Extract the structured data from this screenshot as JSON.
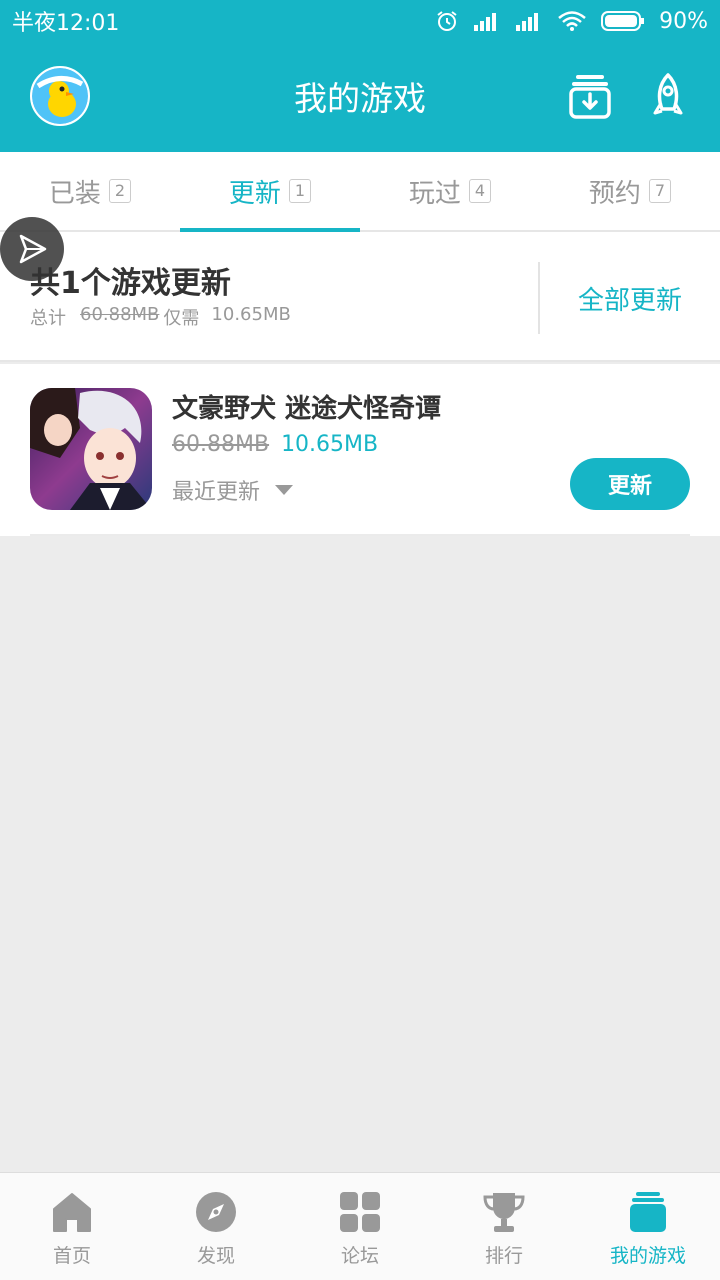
{
  "status_bar": {
    "time": "半夜12:01",
    "battery": "90%"
  },
  "header": {
    "title": "我的游戏"
  },
  "tabs": [
    {
      "label": "已装",
      "count": "2"
    },
    {
      "label": "更新",
      "count": "1",
      "active": true
    },
    {
      "label": "玩过",
      "count": "4"
    },
    {
      "label": "预约",
      "count": "7"
    }
  ],
  "summary": {
    "title": "共1个游戏更新",
    "total_label": "总计",
    "total_size": "60.88MB",
    "only_label": "仅需",
    "only_size": "10.65MB",
    "update_all": "全部更新"
  },
  "games": [
    {
      "name": "文豪野犬 迷途犬怪奇谭",
      "old_size": "60.88MB",
      "new_size": "10.65MB",
      "recent_label": "最近更新",
      "update_label": "更新"
    }
  ],
  "bottom_nav": [
    {
      "label": "首页",
      "icon": "home-icon"
    },
    {
      "label": "发现",
      "icon": "compass-icon"
    },
    {
      "label": "论坛",
      "icon": "grid-icon"
    },
    {
      "label": "排行",
      "icon": "trophy-icon"
    },
    {
      "label": "我的游戏",
      "icon": "stack-icon",
      "active": true
    }
  ],
  "colors": {
    "accent": "#16b5c6",
    "background": "#ececec"
  }
}
